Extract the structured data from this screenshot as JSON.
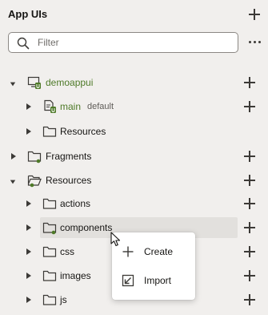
{
  "header": {
    "title": "App UIs"
  },
  "filter": {
    "placeholder": "Filter",
    "value": ""
  },
  "tree": {
    "demoappui": {
      "label": "demoappui"
    },
    "main": {
      "label": "main",
      "tag": "default"
    },
    "main_resources": {
      "label": "Resources"
    },
    "fragments": {
      "label": "Fragments"
    },
    "resources": {
      "label": "Resources"
    },
    "actions": {
      "label": "actions"
    },
    "components": {
      "label": "components"
    },
    "css": {
      "label": "css"
    },
    "images": {
      "label": "images"
    },
    "js": {
      "label": "js"
    }
  },
  "context_menu": {
    "create": "Create",
    "import": "Import"
  },
  "colors": {
    "accent_green": "#4e7a28",
    "background": "#f1efed",
    "selected_row": "#e2e0dd"
  }
}
